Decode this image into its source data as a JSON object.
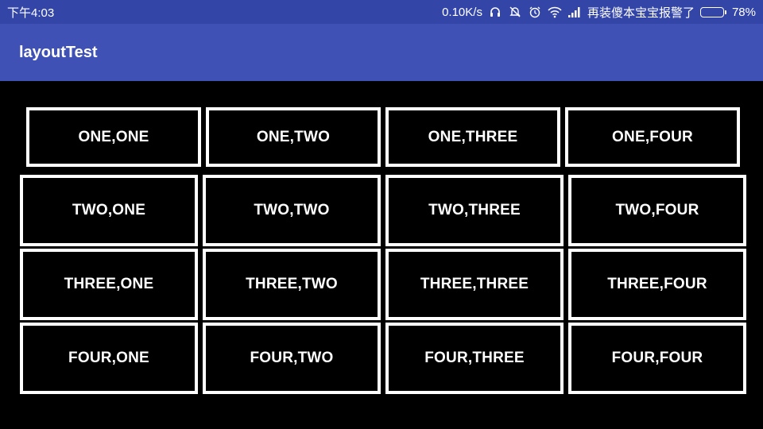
{
  "status_bar": {
    "time": "下午4:03",
    "network_speed": "0.10K/s",
    "carrier": "再装傻本宝宝报警了",
    "battery_percent": "78%",
    "battery_level": 0.78,
    "icons": [
      "headset-icon",
      "mute-icon",
      "alarm-icon",
      "wifi-icon",
      "signal-icon",
      "battery-icon"
    ]
  },
  "app_bar": {
    "title": "layoutTest",
    "color": "#3f51b5"
  },
  "grid": {
    "rows": [
      {
        "cells": [
          "ONE,ONE",
          "ONE,TWO",
          "ONE,THREE",
          "ONE,FOUR"
        ]
      },
      {
        "cells": [
          "TWO,ONE",
          "TWO,TWO",
          "TWO,THREE",
          "TWO,FOUR"
        ]
      },
      {
        "cells": [
          "THREE,ONE",
          "THREE,TWO",
          "THREE,THREE",
          "THREE,FOUR"
        ]
      },
      {
        "cells": [
          "FOUR,ONE",
          "FOUR,TWO",
          "FOUR,THREE",
          "FOUR,FOUR"
        ]
      }
    ]
  }
}
